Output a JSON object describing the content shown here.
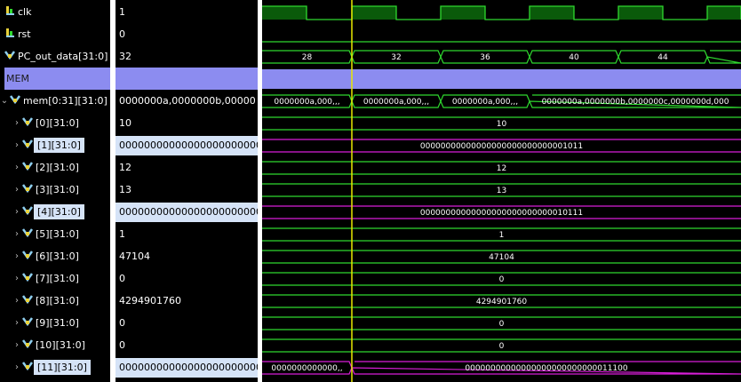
{
  "colors": {
    "wave": "#2fd82f",
    "clk_fill": "#0a5a0a",
    "highlight_wave": "#d81ed8",
    "group_bar": "#8c8cf0",
    "cursor": "#e8e800",
    "selected_value_bg": "#d5e3f7"
  },
  "signals": [
    {
      "name": "clk",
      "value": "1",
      "icon": "bit-icon"
    },
    {
      "name": "rst",
      "value": "0",
      "icon": "bit-icon"
    },
    {
      "name": "PC_out_data[31:0]",
      "value": "32",
      "icon": "bus-icon"
    },
    {
      "name": "MEM",
      "value": "",
      "group": true
    },
    {
      "name": "mem[0:31][31:0]",
      "value": "0000000a,0000000b,00000",
      "icon": "bus-icon",
      "expanded": true
    },
    {
      "name": "[0][31:0]",
      "value": "10",
      "icon": "bus-icon",
      "sub": true
    },
    {
      "name": "[1][31:0]",
      "value": "00000000000000000000000000001011",
      "icon": "bus-icon",
      "sub": true,
      "selected": true
    },
    {
      "name": "[2][31:0]",
      "value": "12",
      "icon": "bus-icon",
      "sub": true
    },
    {
      "name": "[3][31:0]",
      "value": "13",
      "icon": "bus-icon",
      "sub": true
    },
    {
      "name": "[4][31:0]",
      "value": "00000000000000000000000000010111",
      "icon": "bus-icon",
      "sub": true,
      "selected": true
    },
    {
      "name": "[5][31:0]",
      "value": "1",
      "icon": "bus-icon",
      "sub": true
    },
    {
      "name": "[6][31:0]",
      "value": "47104",
      "icon": "bus-icon",
      "sub": true
    },
    {
      "name": "[7][31:0]",
      "value": "0",
      "icon": "bus-icon",
      "sub": true
    },
    {
      "name": "[8][31:0]",
      "value": "4294901760",
      "icon": "bus-icon",
      "sub": true
    },
    {
      "name": "[9][31:0]",
      "value": "0",
      "icon": "bus-icon",
      "sub": true
    },
    {
      "name": "[10][31:0]",
      "value": "0",
      "icon": "bus-icon",
      "sub": true
    },
    {
      "name": "[11][31:0]",
      "value": "00000000000000000000000000011100",
      "icon": "bus-icon",
      "sub": true,
      "selected": true
    }
  ],
  "waves": {
    "pc_labels": [
      "28",
      "32",
      "36",
      "40",
      "44"
    ],
    "mem_labels": [
      "0000000a,000,,,",
      "0000000a,000,,,",
      "0000000a,000,,,",
      "0000000a,0000000b,0000000c,0000000d,000"
    ],
    "row_labels": {
      "5": "10",
      "6": "00000000000000000000000000001011",
      "7": "12",
      "8": "13",
      "9": "00000000000000000000000000010111",
      "10": "1",
      "11": "47104",
      "12": "0",
      "13": "4294901760",
      "14": "0",
      "15": "0"
    },
    "row11_before": "0000000000000,,",
    "row11_after": "00000000000000000000000000011100"
  }
}
